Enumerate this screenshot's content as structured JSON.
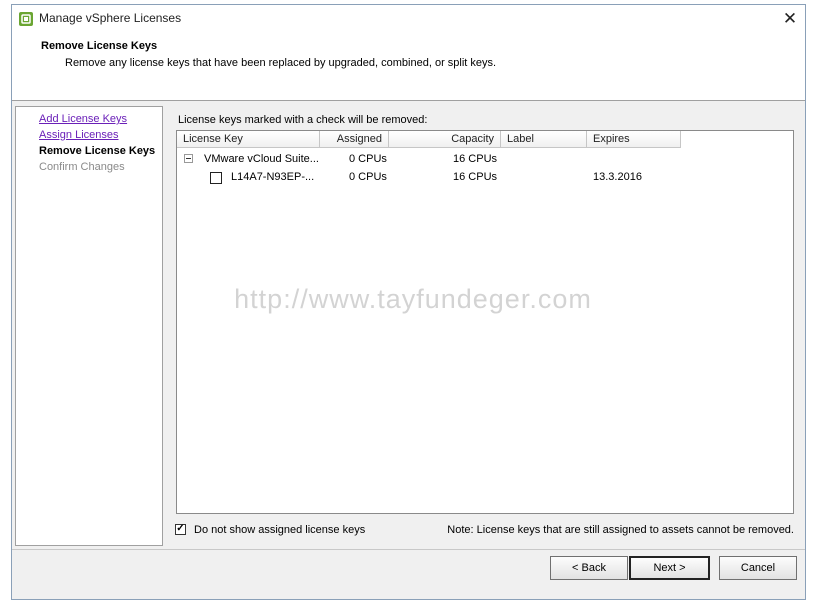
{
  "window": {
    "title": "Manage vSphere Licenses"
  },
  "header": {
    "title": "Remove License Keys",
    "subtitle": "Remove any license keys that have been replaced by upgraded, combined, or split keys."
  },
  "steps": [
    {
      "label": "Add License Keys",
      "state": "completed"
    },
    {
      "label": "Assign Licenses",
      "state": "completed"
    },
    {
      "label": "Remove License Keys",
      "state": "current"
    },
    {
      "label": "Confirm Changes",
      "state": "pending"
    }
  ],
  "main": {
    "instruction": "License keys marked with a check will be removed:",
    "columns": [
      "License Key",
      "Assigned",
      "Capacity",
      "Label",
      "Expires"
    ],
    "group": {
      "license_key": "VMware vCloud Suite...",
      "assigned": "0 CPUs",
      "capacity": "16 CPUs",
      "expanded": true
    },
    "rows": [
      {
        "license_key": "L14A7-N93EP-...",
        "assigned": "0 CPUs",
        "capacity": "16 CPUs",
        "label": "",
        "expires": "13.3.2016",
        "checked": false
      }
    ]
  },
  "watermark": "http://www.tayfundeger.com",
  "options": {
    "hide_assigned_label": "Do not show assigned license keys",
    "hide_assigned_checked": true
  },
  "note": "Note: License keys that are still assigned to assets cannot be removed.",
  "buttons": {
    "back": "< Back",
    "next": "Next >",
    "cancel": "Cancel"
  },
  "colors": {
    "link": "#6a1fb8",
    "icon_green": "#6aa532",
    "border": "#a0a0a0"
  }
}
